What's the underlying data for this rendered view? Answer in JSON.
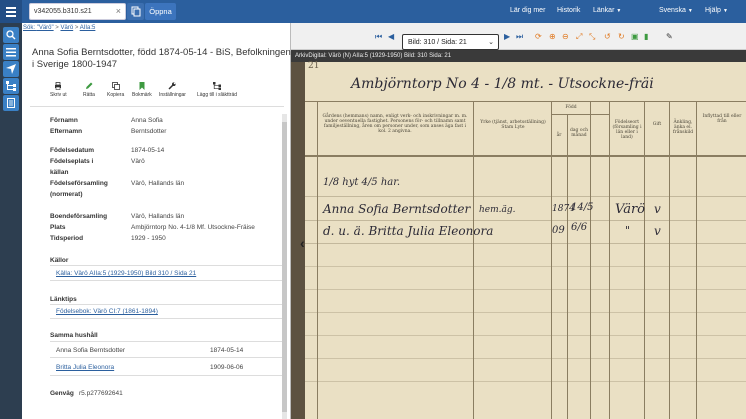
{
  "topbar": {
    "search_value": "v342055.b310.s21",
    "open_label": "Öppna",
    "links": [
      {
        "label": "Lär dig mer"
      },
      {
        "label": "Historik"
      },
      {
        "label": "Länkar"
      },
      {
        "label": "Svenska"
      },
      {
        "label": "Hjälp"
      }
    ]
  },
  "breadcrumb": {
    "prefix": "Sök:",
    "query": "\"Värö\"",
    "sep1": ">",
    "place": "Värö",
    "sep2": ">",
    "current": "AIIa:5"
  },
  "record": {
    "title": "Anna Sofia Berntsdotter, född 1874-05-14 - BiS, Befolkningen i Sverige 1800-1947",
    "toolbar": [
      {
        "label": "Skriv ut",
        "icon": "printer-icon"
      },
      {
        "label": "Rätta",
        "icon": "pencil-icon"
      },
      {
        "label": "Kopiera",
        "icon": "copy-icon"
      },
      {
        "label": "Bokmärk",
        "icon": "bookmark-icon"
      },
      {
        "label": "Inställningar",
        "icon": "wrench-icon"
      },
      {
        "label": "Lägg till i släktträd",
        "icon": "tree-icon"
      }
    ],
    "fields": [
      {
        "label": "Förnamn",
        "value": "Anna Sofia"
      },
      {
        "label": "Efternamn",
        "value": "Berntsdotter"
      },
      {
        "label": "Födelsedatum",
        "value": "1874-05-14"
      },
      {
        "label": "Födelseplats i",
        "value": "Värö"
      },
      {
        "label": "källan",
        "value": ""
      },
      {
        "label": "Födelseförsamling",
        "value": "Värö, Hallands län"
      },
      {
        "label": "(normerat)",
        "value": ""
      },
      {
        "label": "Boendeförsamling",
        "value": "Värö, Hallands län"
      },
      {
        "label": "Plats",
        "value": "Ambjörntorp No. 4-1/8 Mf. Utsockne-Fräise"
      },
      {
        "label": "Tidsperiod",
        "value": "1929 - 1950"
      }
    ],
    "sources_title": "Källor",
    "source_link": "Källa: Värö AIIa:5 (1929-1950) Bild 310 / Sida 21",
    "tips_title": "Länktips",
    "tip_link": "Födelsebok: Värö CI:7 (1861-1894)",
    "household_title": "Samma hushåll",
    "household": [
      {
        "name": "Anna Sofia Berntsdotter",
        "date": "1874-05-14"
      },
      {
        "name": "Britta Julia Eleonora",
        "date": "1909-06-06"
      }
    ],
    "shortcut_label": "Genväg",
    "shortcut_value": "r5.p277692641"
  },
  "viewer": {
    "page_select": "Bild: 310 / Sida: 21",
    "header": "ArkivDigital: Värö (N) AIIa:5 (1929-1950) Bild: 310 Sida: 21",
    "doc": {
      "page_number": "21",
      "heading": "Ambjörntorp No 4 - 1/8 mt. - Utsockne-fräi",
      "col_place": "Gårdens (hemmans) namn, enligt verk- och inskrivningar m. m. under oeventuella fastighet. Personens för- och tillnamn samt familjeställning, åren om personer under, som anses äga fast i kol. 2 angivna.",
      "col_work": "Yrke (tjänst, arbetsställning) Stam Lyte",
      "col_born": "Född",
      "col_year": "år",
      "col_day": "dag och månad",
      "col_birthplace": "Födelseort (församling i län eller i land)",
      "col_married": "Gift",
      "col_widow": "Änkling, änka el. frånskild",
      "col_moved_in": "Inflyttad till eller från",
      "note": "1/8 hyt 4/5 har.",
      "rows": [
        {
          "name": "Anna Sofia Berntsdotter",
          "work": "hem.äg.",
          "year": "1874",
          "day": "14/5",
          "place": "Värö",
          "mark": "v"
        },
        {
          "name": "d. u. ä. Britta Julia Eleonora",
          "work": "",
          "year": "09",
          "day": "6/6",
          "place": "\"",
          "mark": "v"
        }
      ]
    }
  }
}
